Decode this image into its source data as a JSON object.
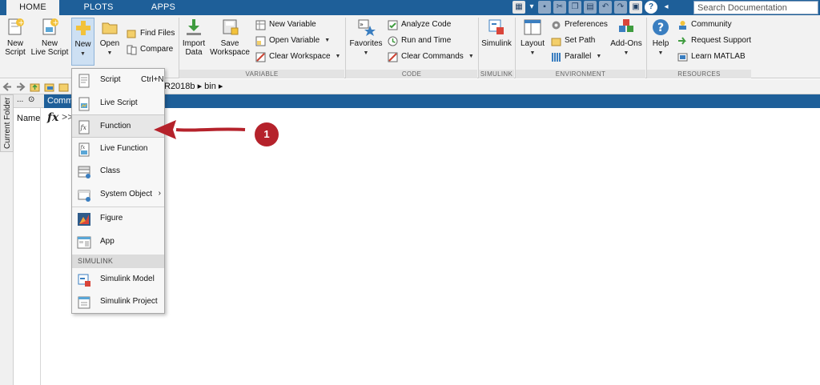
{
  "tabs": [
    {
      "label": "HOME",
      "active": true
    },
    {
      "label": "PLOTS",
      "active": false
    },
    {
      "label": "APPS",
      "active": false
    }
  ],
  "search": {
    "placeholder": "Search Documentation"
  },
  "ribbon": {
    "file": {
      "new_script": [
        "New",
        "Script"
      ],
      "new_live_script": [
        "New",
        "Live Script"
      ],
      "new": "New",
      "open": "Open",
      "find_files": "Find Files",
      "compare": "Compare"
    },
    "variable": {
      "label": "VARIABLE",
      "import_data": [
        "Import",
        "Data"
      ],
      "save_workspace": [
        "Save",
        "Workspace"
      ],
      "new_variable": "New Variable",
      "open_variable": "Open Variable",
      "clear_workspace": "Clear Workspace"
    },
    "code": {
      "label": "CODE",
      "favorites": "Favorites",
      "analyze_code": "Analyze Code",
      "run_and_time": "Run and Time",
      "clear_commands": "Clear Commands"
    },
    "simulink": {
      "label": "SIMULINK",
      "simulink": "Simulink"
    },
    "environment": {
      "label": "ENVIRONMENT",
      "layout": "Layout",
      "preferences": "Preferences",
      "set_path": "Set Path",
      "parallel": "Parallel",
      "add_ons": "Add-Ons"
    },
    "resources": {
      "label": "RESOURCES",
      "help": "Help",
      "community": "Community",
      "request_support": "Request Support",
      "learn_matlab": "Learn MATLAB"
    }
  },
  "address": {
    "path_tail": "R2018b ▸ bin ▸"
  },
  "current_folder": {
    "tab_label": "Current Folder",
    "header_dots": "...",
    "name_col": "Name"
  },
  "command_window": {
    "title": "Comm",
    "fx": "fx",
    "prompt": ">>"
  },
  "new_menu": {
    "items": [
      {
        "label": "Script",
        "shortcut": "Ctrl+N"
      },
      {
        "label": "Live Script"
      },
      {
        "label": "Function"
      },
      {
        "label": "Live Function"
      },
      {
        "label": "Class"
      },
      {
        "label": "System Object",
        "submenu": "›"
      },
      {
        "label": "Figure"
      },
      {
        "label": "App"
      },
      {
        "label": "Simulink Model"
      },
      {
        "label": "Simulink Project"
      }
    ],
    "section_header": "SIMULINK"
  },
  "annotation": {
    "badge": "1",
    "color": "#b5222b"
  },
  "colors": {
    "accent": "#1e5f99",
    "ribbon_bg": "#f2f2f2",
    "highlight": "#cde0f3"
  }
}
